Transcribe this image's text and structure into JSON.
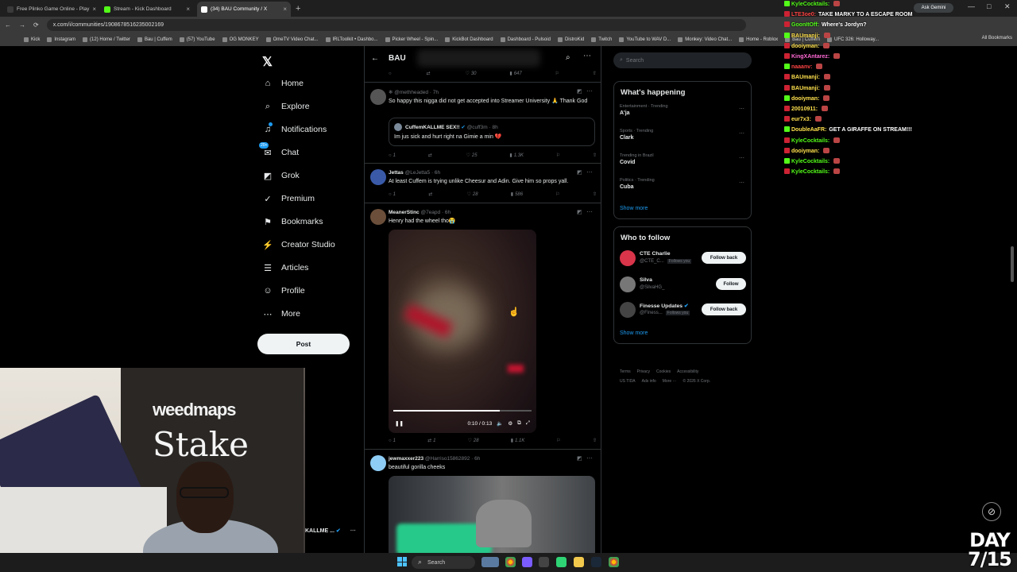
{
  "browser": {
    "tabs": [
      {
        "title": "Free Plinko Game Online - Play",
        "color": "#3a3a3a"
      },
      {
        "title": "Stream - Kick Dashboard",
        "color": "#53fc18"
      },
      {
        "title": "(34) BAU Community / X",
        "color": "#ffffff"
      }
    ],
    "new_tab": "+",
    "url": "x.com/i/communities/1908678516235002169",
    "bookmarks": [
      "Kick",
      "Instagram",
      "(12) Home / Twitter",
      "Bau | Cuffem",
      "(57) YouTube",
      "OG MONKEY",
      "OmeTV Video Chat...",
      "IRLToolkit • Dashbo...",
      "Picker Wheel - Spin...",
      "KickBot Dashboard",
      "Dashboard - Pulsoid",
      "DistroKid",
      "Twitch",
      "YouTube to WAV D...",
      "Monkey: Video Chat...",
      "Home - Roblox",
      "Bau | Cuffem",
      "UFC 326: Holloway..."
    ],
    "all_bookmarks": "All Bookmarks",
    "ask_gemini": "Ask Gemini"
  },
  "nav": {
    "items": [
      {
        "label": "Home",
        "icon": "home-icon",
        "glyph": "⌂"
      },
      {
        "label": "Explore",
        "icon": "search-icon",
        "glyph": "⌕"
      },
      {
        "label": "Notifications",
        "icon": "bell-icon",
        "glyph": "♫"
      },
      {
        "label": "Chat",
        "icon": "chat-icon",
        "glyph": "✉"
      },
      {
        "label": "Grok",
        "icon": "grok-icon",
        "glyph": "◩"
      },
      {
        "label": "Premium",
        "icon": "premium-icon",
        "glyph": "✓"
      },
      {
        "label": "Bookmarks",
        "icon": "bookmark-icon",
        "glyph": "⚑"
      },
      {
        "label": "Creator Studio",
        "icon": "creator-studio-icon",
        "glyph": "⚡"
      },
      {
        "label": "Articles",
        "icon": "articles-icon",
        "glyph": "☰"
      },
      {
        "label": "Profile",
        "icon": "profile-icon",
        "glyph": "☺"
      },
      {
        "label": "More",
        "icon": "more-icon",
        "glyph": "⋯"
      }
    ],
    "post_label": "Post",
    "chat_badge": "20+",
    "logo": "𝕏"
  },
  "header": {
    "title": "BAU",
    "back": "←"
  },
  "tweets": [
    {
      "actions": [
        "",
        "",
        "30",
        "647"
      ]
    },
    {
      "name": "",
      "handle": "@methheaded · 7h",
      "text": "So happy this nigga did not get accepted into Streamer University 🙏 Thank God",
      "quote": {
        "name": "CuffemKALLME SEX!!",
        "handle": "@cuff3m · 8h",
        "text": "Im jus sick and hurt right na Gimie a min 💔"
      },
      "actions": [
        "1",
        "",
        "25",
        "1.3K"
      ]
    },
    {
      "name": "Jettas",
      "handle": "@LeJetta5 · 6h",
      "text": "At least Cuffem is trying unlike Cheesur and Adin. Give him so props yall.",
      "actions": [
        "1",
        "",
        "28",
        "586"
      ]
    },
    {
      "name": "MeanerStinc",
      "handle": "@7eapd · 6h",
      "text": "Henry had the wheel tho😭",
      "video_time": "0:10 / 0:13",
      "video_progress": 0.77,
      "actions": [
        "1",
        "1",
        "28",
        "1.1K"
      ]
    },
    {
      "name": "jewmaxxer223",
      "handle": "@Harriso15862892 · 6h",
      "text": "beautiful gorilla cheeks"
    }
  ],
  "sidebar": {
    "search_placeholder": "Search",
    "happening_title": "What's happening",
    "trends": [
      {
        "context": "Entertainment · Trending",
        "name": "A'ja"
      },
      {
        "context": "Sports · Trending",
        "name": "Clark"
      },
      {
        "context": "Trending in Brazil",
        "name": "Covid"
      },
      {
        "context": "Politics · Trending",
        "name": "Cuba"
      }
    ],
    "show_more": "Show more",
    "follow_title": "Who to follow",
    "follows": [
      {
        "name": "CTE Charlie",
        "handle": "@CTE_C...",
        "follows_you": "Follows you",
        "button": "Follow back",
        "color": "#d8344a"
      },
      {
        "name": "Silva",
        "handle": "@SilvaHG_",
        "follows_you": "",
        "button": "Follow",
        "color": "#777777"
      },
      {
        "name": "Finesse Updates",
        "handle": "@Finess...",
        "follows_you": "Follows you",
        "button": "Follow back",
        "color": "#444444"
      }
    ],
    "footer": [
      "Terms",
      "Privacy",
      "Cookies",
      "Accessibility"
    ],
    "footer2": [
      "US TIDA",
      "Ads info",
      "More ···",
      "© 2026 X Corp."
    ]
  },
  "chat": [
    {
      "user": "KyleCocktails:",
      "msg": "",
      "color": "#53fc18"
    },
    {
      "user": "LTE3oe0:",
      "msg": "TAKE MARKY TO A ESCAPE ROOM",
      "color": "#ff4444"
    },
    {
      "user": "GoonItOff:",
      "msg": "Where's Jordyn?",
      "color": "#53fc18"
    },
    {
      "user": "BAUmanji:",
      "msg": "",
      "color": "#ffe14d"
    },
    {
      "user": "dooiyman:",
      "msg": "",
      "color": "#ffe14d"
    },
    {
      "user": "KingXAntarez:",
      "msg": "",
      "color": "#ff6ad5"
    },
    {
      "user": "naaanv:",
      "msg": "",
      "color": "#ff4444"
    },
    {
      "user": "BAUmanji:",
      "msg": "",
      "color": "#ffe14d"
    },
    {
      "user": "BAUmanji:",
      "msg": "",
      "color": "#ffe14d"
    },
    {
      "user": "dooiyman:",
      "msg": "",
      "color": "#ffe14d"
    },
    {
      "user": "20010911:",
      "msg": "",
      "color": "#ffe14d"
    },
    {
      "user": "eur7x3:",
      "msg": "",
      "color": "#ffe14d"
    },
    {
      "user": "DoubleAaFR:",
      "msg": "GET A GIRAFFE ON STREAM!!!",
      "color": "#ffe14d"
    },
    {
      "user": "KyleCocktails:",
      "msg": "",
      "color": "#53fc18"
    },
    {
      "user": "dooiyman:",
      "msg": "",
      "color": "#ffe14d"
    },
    {
      "user": "KyleCocktails:",
      "msg": "",
      "color": "#53fc18"
    },
    {
      "user": "KyleCocktails:",
      "msg": "",
      "color": "#53fc18"
    }
  ],
  "webcam": {
    "brand1": "weedmaps",
    "brand2": "Stake"
  },
  "side_user": "KALLME ...",
  "overlay": {
    "day": "DAY\n7/15"
  },
  "taskbar": {
    "search": "Search"
  }
}
